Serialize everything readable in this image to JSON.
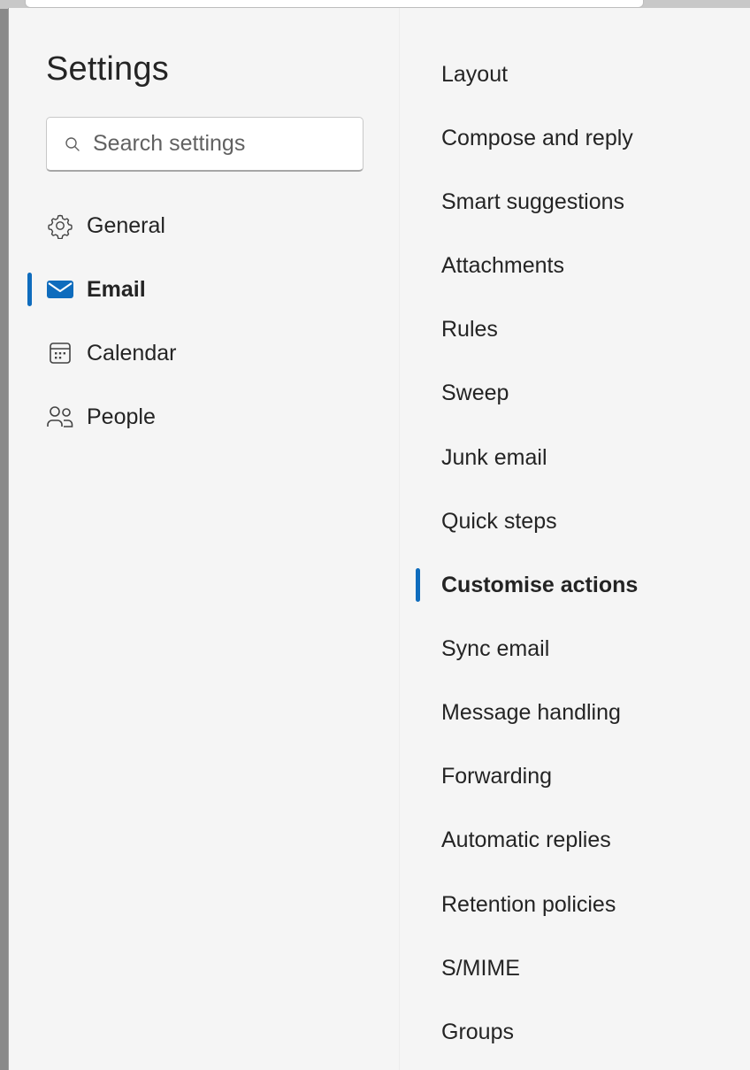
{
  "settings": {
    "title": "Settings",
    "search_placeholder": "Search settings"
  },
  "nav": {
    "items": [
      {
        "label": "General",
        "icon": "gear-icon"
      },
      {
        "label": "Email",
        "icon": "mail-icon",
        "active": true
      },
      {
        "label": "Calendar",
        "icon": "calendar-icon"
      },
      {
        "label": "People",
        "icon": "people-icon"
      }
    ]
  },
  "email_sections": {
    "items": [
      {
        "label": "Layout"
      },
      {
        "label": "Compose and reply"
      },
      {
        "label": "Smart suggestions"
      },
      {
        "label": "Attachments"
      },
      {
        "label": "Rules"
      },
      {
        "label": "Sweep"
      },
      {
        "label": "Junk email"
      },
      {
        "label": "Quick steps"
      },
      {
        "label": "Customise actions",
        "active": true
      },
      {
        "label": "Sync email"
      },
      {
        "label": "Message handling"
      },
      {
        "label": "Forwarding"
      },
      {
        "label": "Automatic replies"
      },
      {
        "label": "Retention policies"
      },
      {
        "label": "S/MIME"
      },
      {
        "label": "Groups"
      }
    ]
  },
  "colors": {
    "accent": "#0f6cbd",
    "pane_background": "#f5f5f5",
    "text": "#242424"
  }
}
